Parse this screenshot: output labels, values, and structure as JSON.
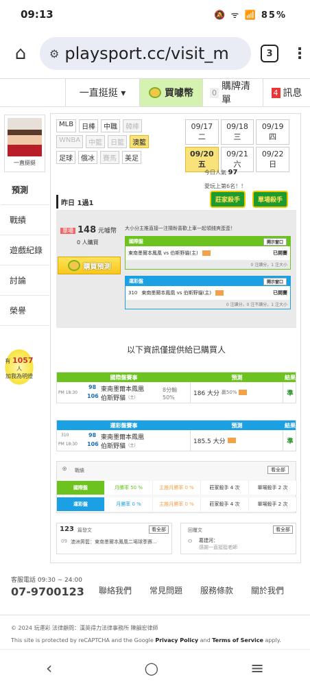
{
  "status": {
    "time": "09:13",
    "icons": "🔕 ᯤ 📶",
    "battery": "85%"
  },
  "browser": {
    "url": "playsport.cc/visit_m",
    "tab_count": "3"
  },
  "topnav": {
    "user": "一直挺挺 ▾",
    "buy": "買噱幣",
    "cart_count": "0",
    "cart": "購牌清單",
    "msg_count": "4",
    "msg": "訊息"
  },
  "profile": {
    "name": "一直挺挺"
  },
  "sidemenu": [
    "預測",
    "戰績",
    "遊戲紀錄",
    "討論",
    "榮譽"
  ],
  "popularity": {
    "prefix": "有",
    "count": "1057",
    "suffix": "人",
    "line2": "加我為明燈"
  },
  "leagues": {
    "row1": [
      {
        "t": "MLB",
        "s": ""
      },
      {
        "t": "日棒",
        "s": ""
      },
      {
        "t": "中職",
        "s": ""
      },
      {
        "t": "韓棒",
        "s": "dim"
      }
    ],
    "row2": [
      {
        "t": "WNBA",
        "s": "dim"
      },
      {
        "t": "中籃",
        "s": "dim"
      },
      {
        "t": "日籃",
        "s": "dim"
      },
      {
        "t": "澳籃",
        "s": "sel"
      }
    ],
    "row3": [
      {
        "t": "足球",
        "s": ""
      },
      {
        "t": "俄冰",
        "s": ""
      },
      {
        "t": "賽馬",
        "s": "dim"
      },
      {
        "t": "美足",
        "s": ""
      }
    ]
  },
  "dates": [
    {
      "t": "09/17 二",
      "s": ""
    },
    {
      "t": "09/18 三",
      "s": ""
    },
    {
      "t": "09/19 四",
      "s": ""
    },
    {
      "t": "09/20 五",
      "s": "sel"
    },
    {
      "t": "09/21 六",
      "s": ""
    },
    {
      "t": "09/22 日",
      "s": ""
    }
  ],
  "today": {
    "label": "今日人氣",
    "value": "97",
    "line2": "愛玩上第6名！！"
  },
  "badges": [
    "莊家殺手",
    "單場殺手"
  ],
  "record": "昨日 1過1",
  "panel": {
    "price_tag": "單場",
    "price": "148",
    "price_unit": "元噱幣",
    "buyers_count": "0",
    "buyers_label": "人購買",
    "buy_btn": "購買預測",
    "desc": "大小分主推直接一注猜盼喜歡上車一起領錢爽歪歪！",
    "intl": {
      "head": "國際盤",
      "open": "開示窗口",
      "match": "東南墨爾本鳳凰 vs 伯斯野貓(主)",
      "status": "已開賽",
      "note": "0 注讀分，1 注大小"
    },
    "lottery": {
      "head": "運彩盤",
      "open": "開示窗口",
      "num": "310",
      "match": "東南墨爾本鳳凰 vs 伯斯野貓(主)",
      "status": "已開賽",
      "note": "0 注讀分，0 注不讀分，1 注大小"
    }
  },
  "notice": "以下資訊僅提供給已購買人",
  "intl_table": {
    "head": [
      "國際盤賽事",
      "預測",
      "結果"
    ],
    "time": "PM 18:30",
    "n1": "98",
    "t1": "東南墨爾本鳳凰",
    "n2": "106",
    "t2": "伯斯野貓",
    "host": "(主)",
    "line": "8分輸",
    "pct": "50%",
    "pred": "186 大分",
    "win": "贏50%",
    "result": "準"
  },
  "lottery_table": {
    "head": [
      "運彩盤賽事",
      "預測",
      "結果"
    ],
    "code": "310",
    "time": "PM 18:30",
    "n1": "98",
    "t1": "東南墨爾本鳳凰",
    "n2": "106",
    "t2": "伯斯野貓",
    "host": "(主)",
    "pred": "185.5 大分",
    "result": "準"
  },
  "stats": {
    "title": "戰績",
    "more": "看全部",
    "intl": {
      "label": "國際盤",
      "a": "月勝率 50 %",
      "b": "主推月勝率 0 %",
      "c": "莊家殺手 4 次",
      "d": "單場殺手 2 次"
    },
    "lottery": {
      "label": "運彩盤",
      "a": "月勝率 0 %",
      "b": "主推月勝率 0 %",
      "c": "莊家殺手 4 次",
      "d": "單場殺手 2 次"
    }
  },
  "posts": {
    "count": "123",
    "label": "篇發文",
    "more": "看全部",
    "item": "澳洲男籃：東南墨爾本鳳凰二場球季賽...",
    "day": "09"
  },
  "replies": {
    "label": "回覆文",
    "more": "看全部",
    "item": "葛建河：",
    "sub": "感謝一直挺挺老師"
  },
  "footer": {
    "hours": "客服電話 09:30 ~ 24:00",
    "phone": "07-9700123",
    "links": [
      "聯絡我們",
      "常見問題",
      "服務條款",
      "關於我們"
    ],
    "copy": "© 2024 玩運彩 法律顧問：漢英得力法律事務所 陳韻宏律師",
    "recaptcha": "This site is protected by reCAPTCHA and the Google",
    "privacy": "Privacy Policy",
    "and": "and",
    "terms": "Terms of Service",
    "apply": "apply."
  },
  "colors": {
    "green": "#6cc21e",
    "blue": "#1aa0e3",
    "yellow": "#f9e27a"
  }
}
